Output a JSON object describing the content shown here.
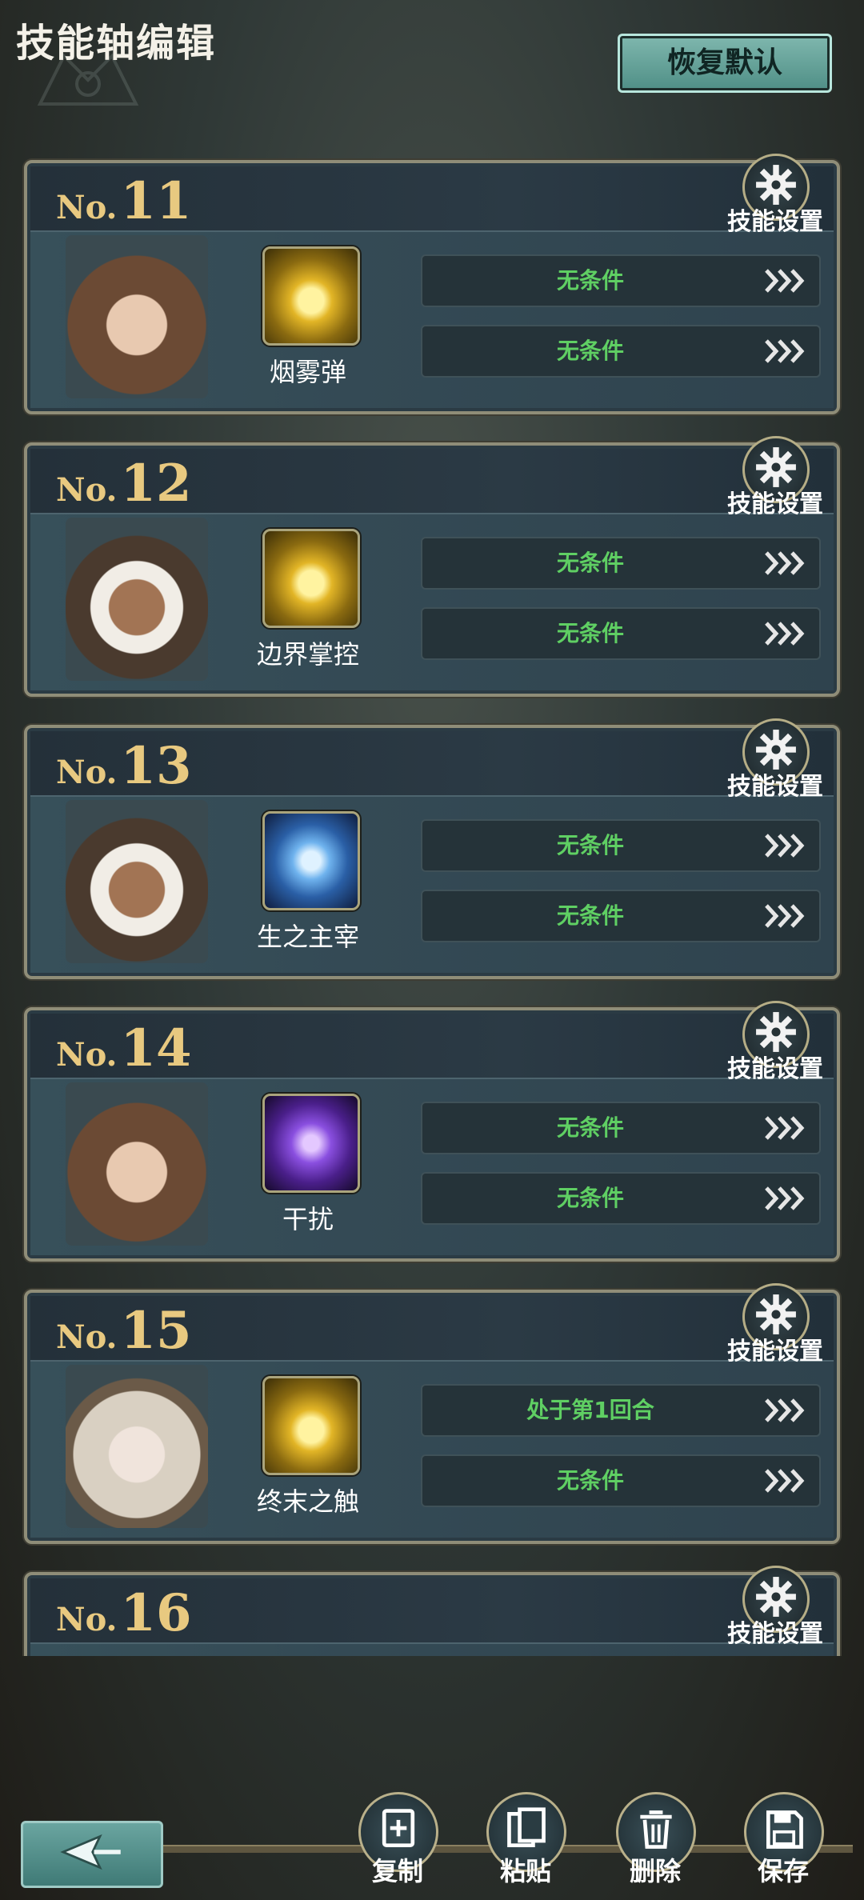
{
  "header": {
    "title": "技能轴编辑",
    "reset_label": "恢复默认"
  },
  "colors": {
    "accent_teal": "#7fb7ae",
    "number_gold": "#e8c980",
    "condition_green": "#5fcf63"
  },
  "cards": [
    {
      "no_prefix": "No.",
      "no_number": "11",
      "settings_label": "技能设置",
      "skill_name": "烟雾弹",
      "skill_icon": "golden-figure-icon",
      "conditions": [
        "无条件",
        "无条件"
      ]
    },
    {
      "no_prefix": "No.",
      "no_number": "12",
      "settings_label": "技能设置",
      "skill_name": "边界掌控",
      "skill_icon": "golden-figure-icon",
      "conditions": [
        "无条件",
        "无条件"
      ]
    },
    {
      "no_prefix": "No.",
      "no_number": "13",
      "settings_label": "技能设置",
      "skill_name": "生之主宰",
      "skill_icon": "blue-shield-icon",
      "conditions": [
        "无条件",
        "无条件"
      ]
    },
    {
      "no_prefix": "No.",
      "no_number": "14",
      "settings_label": "技能设置",
      "skill_name": "干扰",
      "skill_icon": "purple-ghost-icon",
      "conditions": [
        "无条件",
        "无条件"
      ]
    },
    {
      "no_prefix": "No.",
      "no_number": "15",
      "settings_label": "技能设置",
      "skill_name": "终末之触",
      "skill_icon": "golden-figure-icon",
      "conditions": [
        "处于第1回合",
        "无条件"
      ]
    },
    {
      "no_prefix": "No.",
      "no_number": "16",
      "settings_label": "技能设置"
    }
  ],
  "toolbar": {
    "copy_label": "复制",
    "paste_label": "粘贴",
    "delete_label": "删除",
    "save_label": "保存"
  }
}
